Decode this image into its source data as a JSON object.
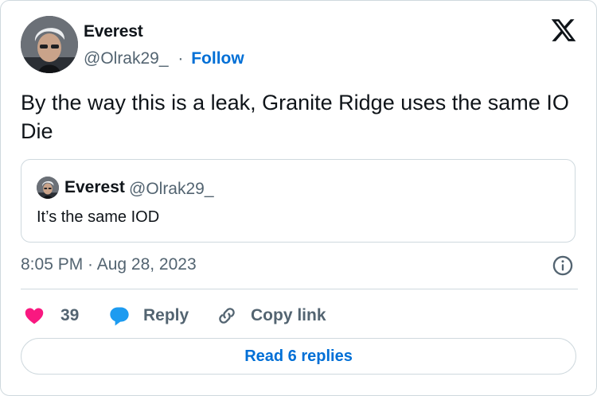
{
  "author": {
    "name": "Everest",
    "handle": "@Olrak29_",
    "separator": "·",
    "follow_label": "Follow",
    "avatar_icon": "user-avatar-photo"
  },
  "tweet": {
    "text": "By the way this is a leak, Granite Ridge uses the same IO Die",
    "timestamp": "8:05 PM · Aug 28, 2023"
  },
  "quote": {
    "name": "Everest",
    "handle": "@Olrak29_",
    "text": "It’s the same IOD"
  },
  "actions": {
    "like_count": "39",
    "reply_label": "Reply",
    "copy_label": "Copy link"
  },
  "read_replies_label": "Read 6 replies",
  "colors": {
    "accent": "#006fd6",
    "like": "#f91880",
    "reply_icon": "#1d9bf0",
    "muted": "#536471",
    "border": "#cfd9de"
  },
  "icons": [
    "x-logo-icon",
    "info-icon",
    "heart-icon",
    "reply-bubble-icon",
    "link-icon"
  ]
}
